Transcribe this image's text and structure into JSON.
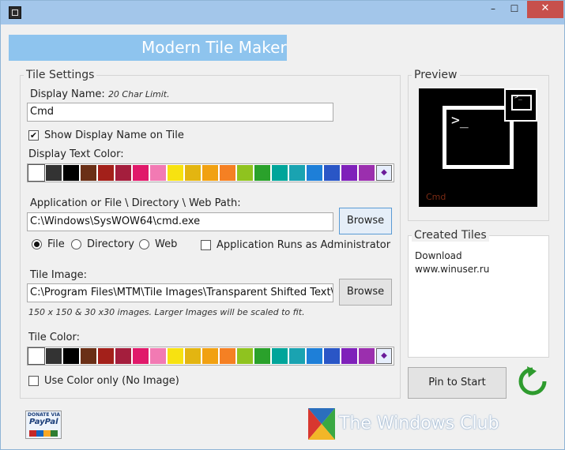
{
  "window": {
    "minimize": "–",
    "maximize": "☐",
    "close": "✕"
  },
  "header": {
    "title": "Modern Tile Maker"
  },
  "tile_settings": {
    "title": "Tile Settings",
    "display_name_label": "Display Name:",
    "display_name_hint": "20 Char Limit.",
    "display_name_value": "Cmd",
    "show_display_name_label": "Show Display Name on Tile",
    "show_display_name_checked": true,
    "display_text_color_label": "Display Text Color:",
    "path_label": "Application or File \\ Directory \\ Web Path:",
    "path_value": "C:\\Windows\\SysWOW64\\cmd.exe",
    "browse_label": "Browse",
    "type_options": [
      "File",
      "Directory",
      "Web"
    ],
    "type_selected": "File",
    "run_as_admin_label": "Application Runs as Administrator",
    "tile_image_label": "Tile Image:",
    "tile_image_value": "C:\\Program Files\\MTM\\Tile Images\\Transparent Shifted Text\\CMD.png",
    "tile_image_hint": "150 x 150 & 30 x30 images. Larger Images will be scaled to fit.",
    "tile_color_label": "Tile Color:",
    "color_only_label": "Use Color only (No Image)",
    "color_only_checked": false
  },
  "palette_colors": [
    "#ffffff",
    "#333333",
    "#000000",
    "#6a2f16",
    "#a3201a",
    "#a41e3d",
    "#e0196a",
    "#f27ab3",
    "#f7e211",
    "#e3b511",
    "#f1a112",
    "#f58023",
    "#8fc31f",
    "#2aa12b",
    "#00a59a",
    "#1aa3b1",
    "#1e7fd8",
    "#2a56c6",
    "#7f21ba",
    "#9b2fae"
  ],
  "preview": {
    "title": "Preview",
    "tile_label": "Cmd",
    "prompt": ">_"
  },
  "created_tiles": {
    "title": "Created Tiles",
    "items": [
      "Download",
      "www.winuser.ru"
    ]
  },
  "pin_button": {
    "label": "Pin to Start"
  },
  "donate": {
    "top_text": "DONATE VIA",
    "logo_text": "PayPal"
  },
  "watermark": {
    "text": "The Windows Club"
  }
}
